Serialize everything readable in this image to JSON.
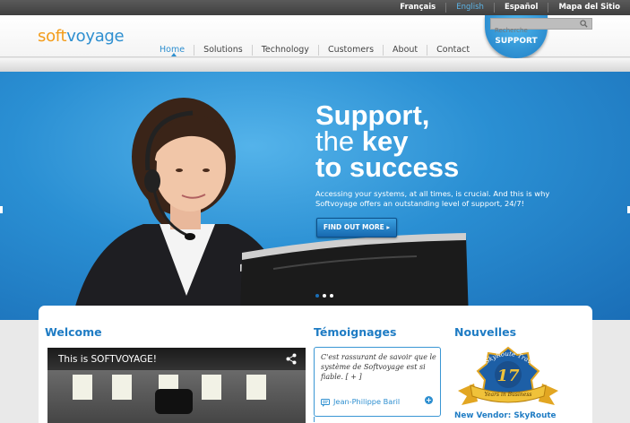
{
  "languages": [
    {
      "label": "Français",
      "active": false
    },
    {
      "label": "English",
      "active": true
    },
    {
      "label": "Español",
      "active": false
    },
    {
      "label": "Mapa del Sitio",
      "active": false
    }
  ],
  "logo": {
    "soft": "soft",
    "voyage": "voyage"
  },
  "nav": [
    {
      "label": "Home",
      "active": true
    },
    {
      "label": "Solutions"
    },
    {
      "label": "Technology"
    },
    {
      "label": "Customers"
    },
    {
      "label": "About"
    },
    {
      "label": "Contact"
    }
  ],
  "search": {
    "placeholder": "Recherche",
    "icon": "search-icon"
  },
  "support_badge": "SUPPORT",
  "hero": {
    "headline_line1": "Support,",
    "headline_line2_pre": "the ",
    "headline_line2_bold": "key",
    "headline_line3": "to success",
    "subtext": "Accessing your systems, at all times, is crucial. And this is why Softvoyage offers an outstanding level of support, 24/7!",
    "cta": "FIND OUT MORE ▸"
  },
  "welcome": {
    "title": "Welcome",
    "video_title": "This is SOFTVOYAGE!"
  },
  "testimonials": {
    "title": "Témoignages",
    "quote": "C'est rassurant de savoir que le système de Softvoyage est si fiable. [ + ]",
    "author": "Jean-Philippe Baril"
  },
  "news": {
    "title": "Nouvelles",
    "award_banner": "SkyRoute Travel",
    "award_number": "17",
    "award_ribbon": "Years in Business",
    "link": "New Vendor: SkyRoute"
  },
  "colors": {
    "accent": "#2e8fd0",
    "logo_orange": "#f39c1a",
    "hero_blue": "#2a8fd3"
  }
}
